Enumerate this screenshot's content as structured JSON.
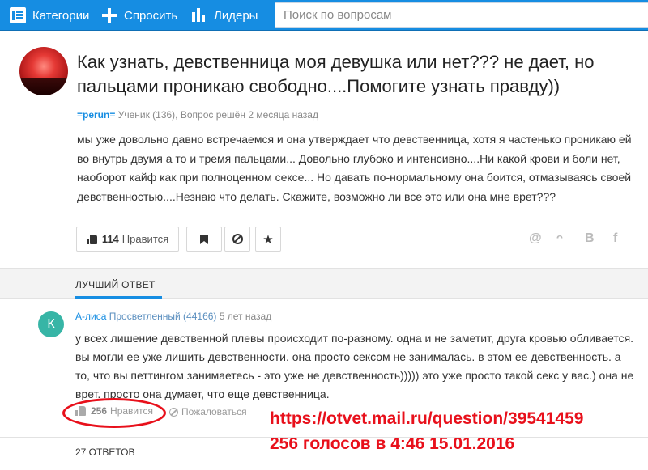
{
  "header": {
    "categories": "Категории",
    "ask": "Спросить",
    "leaders": "Лидеры",
    "search_placeholder": "Поиск по вопросам"
  },
  "question": {
    "title": "Как узнать, девственница моя девушка или нет??? не дает, но пальцами проникаю свободно....Помогите узнать правду))",
    "author": "=perun=",
    "meta": "Ученик (136), Вопрос решён 2 месяца назад",
    "body": "мы уже довольно давно встречаемся и она утверждает что девственница, хотя я частенько проникаю ей во внутрь двумя а то и тремя пальцами... Довольно глубоко и интенсивно....Ни какой крови и боли нет, наоборот кайф как при полноценном сексе... Но давать по-нормальному она боится, отмазываясь своей девственностью....Незнаю что делать. Скажите, возможно ли все это или она мне врет???",
    "likes": "114",
    "like_label": "Нравится",
    "share_icons": [
      "@",
      "ok",
      "B",
      "f"
    ]
  },
  "best_answer": {
    "section_label": "ЛУЧШИЙ ОТВЕТ",
    "avatar_letter": "К",
    "author": "А-лиса",
    "rank": "Просветленный (44166)",
    "time": "5 лет назад",
    "body": "у всех лишение девственной плевы происходит по-разному. одна и не заметит, друга кровью обливается. вы могли ее уже лишить девственности. она просто сексом не занималась. в этом ее девственность. а то, что вы петтингом занимаетесь - это уже не девственность))))) это уже просто такой секс у вас.) она не врет. просто она думает, что еще девственница.",
    "likes": "256",
    "like_label": "Нравится",
    "complain": "Пожаловаться"
  },
  "overlay": {
    "url": "https://otvet.mail.ru/question/39541459",
    "votes": "256 голосов в 4:46 15.01.2016"
  },
  "answers_count": "27 ОТВЕТОВ",
  "colors": {
    "brand": "#168de2",
    "annotation": "#e8101b"
  }
}
